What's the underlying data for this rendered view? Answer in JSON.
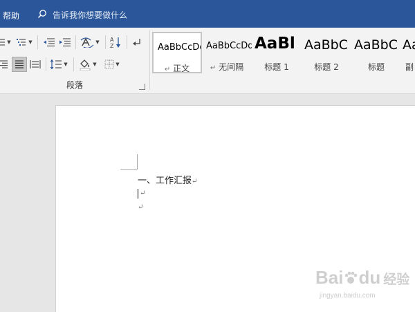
{
  "title_bar": {
    "help_tab": "帮助",
    "tell_me_placeholder": "告诉我你想要做什么",
    "icon": "search-icon"
  },
  "ribbon": {
    "paragraph_group": {
      "label": "段落",
      "buttons": [
        "bullets",
        "numbering",
        "multilevel-list",
        "decrease-indent",
        "increase-indent",
        "chinese-layout",
        "sort",
        "show-formatting-marks",
        "align-right",
        "justify",
        "distributed",
        "line-spacing",
        "shading",
        "borders"
      ],
      "active_button": "justify"
    },
    "styles": [
      {
        "preview": "AaBbCcDd",
        "name": "正文",
        "mark": "↵",
        "selected": true
      },
      {
        "preview": "AaBbCcDd",
        "name": "无间隔",
        "mark": "↵",
        "selected": false
      },
      {
        "preview": "AaBl",
        "name": "标题 1",
        "selected": false
      },
      {
        "preview": "AaBbC",
        "name": "标题 2",
        "selected": false
      },
      {
        "preview": "AaBbC",
        "name": "标题",
        "selected": false
      },
      {
        "preview": "Aa",
        "name": "副",
        "selected": false
      }
    ]
  },
  "document": {
    "lines": [
      {
        "text": "一、工作汇报",
        "mark": "↵"
      },
      {
        "text": "",
        "mark": "↵"
      },
      {
        "text": "",
        "mark": "↵"
      }
    ]
  },
  "watermark": {
    "main": "Bai",
    "du": "du",
    "jingyan": "经验",
    "url": "jingyan.baidu.com"
  },
  "colors": {
    "title_bar": "#2b579a",
    "ribbon": "#f3f3f3",
    "canvas": "#e6e6e6",
    "page": "#ffffff"
  }
}
